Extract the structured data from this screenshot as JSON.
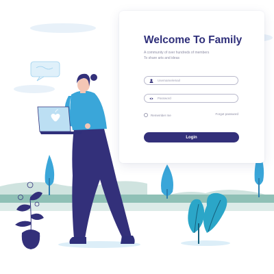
{
  "login": {
    "title": "Welcome To Family",
    "subtitle_line1": "A community of over hundreds of members",
    "subtitle_line2": "To share arts and ideas",
    "username_placeholder": "Username/email",
    "password_placeholder": "Password",
    "remember_label": "Remember me",
    "forgot_label": "Forgot password",
    "login_label": "Login"
  },
  "colors": {
    "brand": "#33307a",
    "title": "#2f2f7a",
    "accent": "#3aa6d9",
    "leaf_teal": "#2ba6c8"
  },
  "icons": {
    "username": "user-icon",
    "password": "eye-icon",
    "laptop_logo": "apple-logo-icon"
  }
}
